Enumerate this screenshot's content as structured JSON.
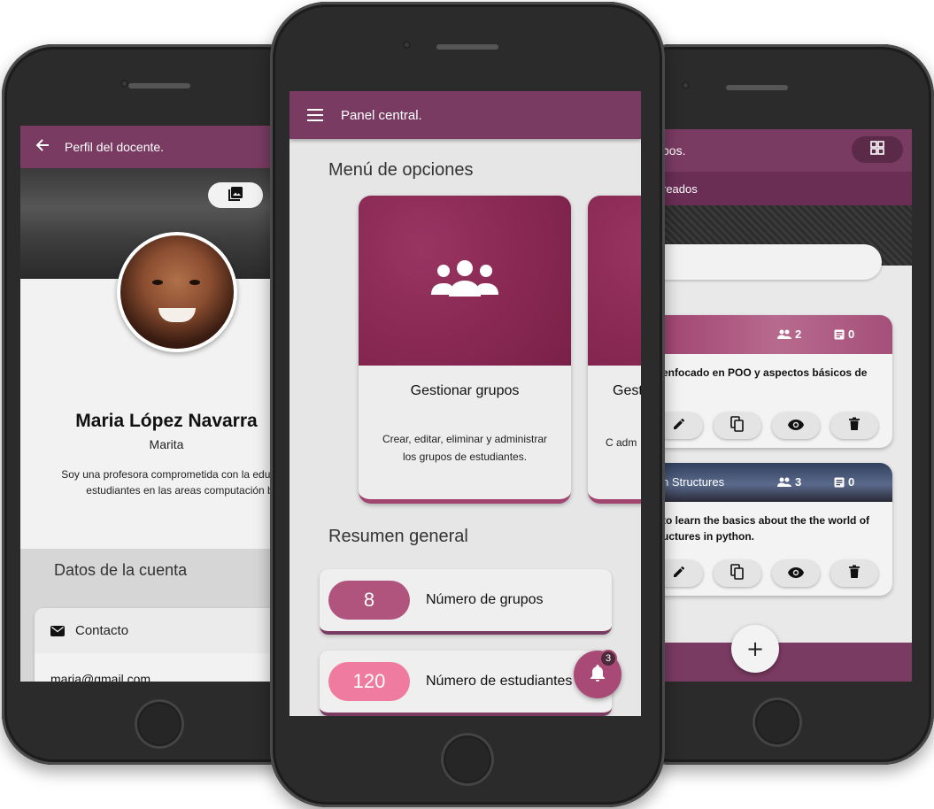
{
  "colors": {
    "primary": "#7a3b62",
    "primary_dark": "#5b2a49",
    "card_top": "#8a2a55",
    "pill_groups": "#b0547e",
    "pill_students": "#f07ba0",
    "fab": "#a94a76"
  },
  "left_screen": {
    "appbar_title": "Perfil del docente.",
    "back_icon": "arrow-back-icon",
    "cover_button_icon": "image-icon",
    "name": "Maria López Navarra",
    "nickname": "Marita",
    "bio": "Soy una profesora comprometida con la educa los estudiantes en las areas computación b",
    "account_section_title": "Datos de la cuenta",
    "contact_label": "Contacto",
    "contact_icon": "mail-icon",
    "email": "maria@gmail.com"
  },
  "middle_screen": {
    "appbar_title": "Panel central.",
    "menu_icon": "menu-icon",
    "options_title": "Menú de opciones",
    "cards": [
      {
        "title": "Gestionar grupos",
        "description": "Crear, editar, eliminar y administrar los grupos de estudiantes.",
        "icon": "groups-icon"
      },
      {
        "title": "Gest",
        "description": "C adm",
        "icon": ""
      }
    ],
    "summary_title": "Resumen general",
    "stats": [
      {
        "value": "8",
        "label": "Número de grupos"
      },
      {
        "value": "120",
        "label": "Número de estudiantes"
      }
    ],
    "notification_icon": "bell-icon",
    "notification_count": "3"
  },
  "right_screen": {
    "appbar_title": "pos.",
    "grid_icon": "grid-icon",
    "subbar_text": "reados",
    "groups": [
      {
        "header_title": "",
        "members": "2",
        "notes": "0",
        "description": "enfocado en POO y aspectos básicos de"
      },
      {
        "header_title": "n Structures",
        "members": "3",
        "notes": "0",
        "description": "to learn the basics about the the world of uctures in python."
      }
    ],
    "add_label": "+"
  }
}
